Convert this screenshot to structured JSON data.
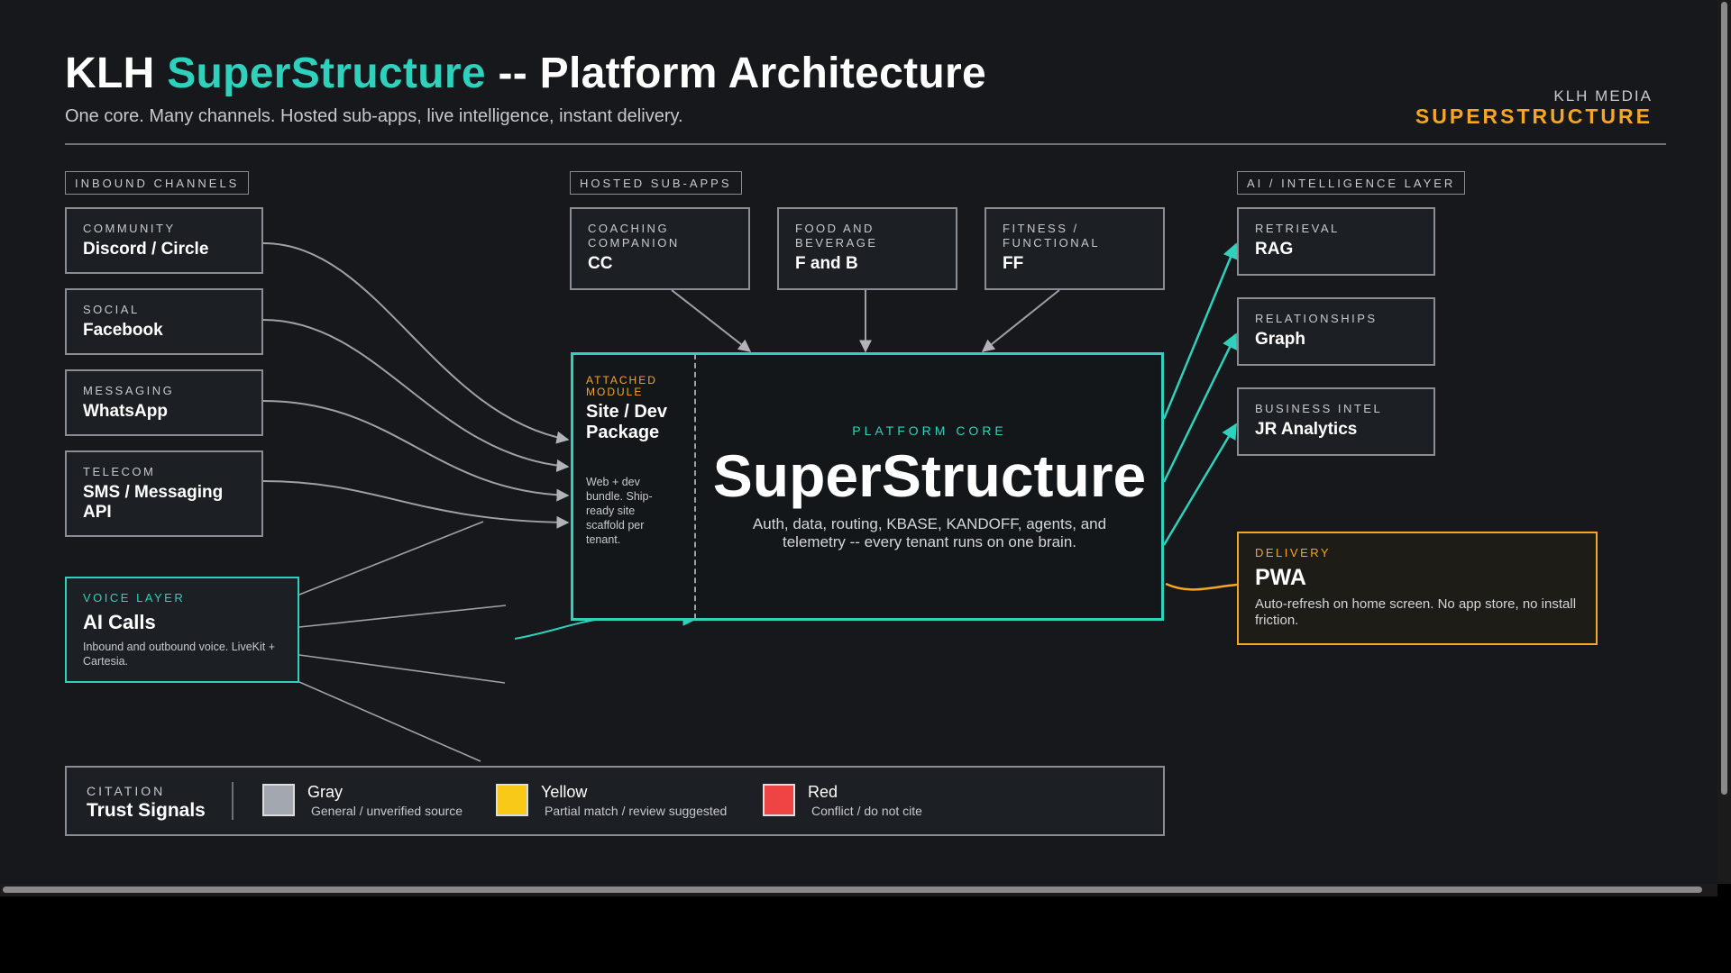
{
  "header": {
    "title_prefix": "KLH",
    "title_accent": "SuperStructure",
    "title_suffix": "-- Platform Architecture",
    "subtitle": "One core. Many channels. Hosted sub-apps, live intelligence, instant delivery.",
    "brand_top": "KLH MEDIA",
    "brand_main": "SUPERSTRUCTURE"
  },
  "sections": {
    "inbound": "INBOUND CHANNELS",
    "hosted": "HOSTED SUB-APPS",
    "ai": "AI / INTELLIGENCE LAYER"
  },
  "inbound": [
    {
      "caption": "COMMUNITY",
      "name": "Discord / Circle"
    },
    {
      "caption": "SOCIAL",
      "name": "Facebook"
    },
    {
      "caption": "MESSAGING",
      "name": "WhatsApp"
    },
    {
      "caption": "TELECOM",
      "name": "SMS / Messaging API"
    }
  ],
  "hosted": [
    {
      "caption": "COACHING COMPANION",
      "name": "CC"
    },
    {
      "caption": "FOOD AND BEVERAGE",
      "name": "F and B"
    },
    {
      "caption": "FITNESS / FUNCTIONAL",
      "name": "FF"
    }
  ],
  "ai": [
    {
      "caption": "RETRIEVAL",
      "name": "RAG"
    },
    {
      "caption": "RELATIONSHIPS",
      "name": "Graph"
    },
    {
      "caption": "BUSINESS INTEL",
      "name": "JR Analytics"
    }
  ],
  "core": {
    "attached_caption": "ATTACHED MODULE",
    "attached_title": "Site / Dev Package",
    "attached_desc": "Web + dev bundle. Ship-ready site scaffold per tenant.",
    "caption": "PLATFORM CORE",
    "title": "SuperStructure",
    "desc": "Auth, data, routing, KBASE, KANDOFF, agents, and telemetry -- every tenant runs on one brain."
  },
  "voice": {
    "caption": "VOICE LAYER",
    "title": "AI Calls",
    "desc": "Inbound and outbound voice. LiveKit + Cartesia."
  },
  "delivery": {
    "caption": "DELIVERY",
    "title": "PWA",
    "desc": "Auto-refresh on home screen. No app store, no install friction."
  },
  "legend": {
    "caption": "CITATION",
    "title": "Trust Signals",
    "items": [
      {
        "label": "Gray",
        "desc": "General / unverified source",
        "color": "#a3a8b0"
      },
      {
        "label": "Yellow",
        "desc": "Partial match / review suggested",
        "color": "#f8c919"
      },
      {
        "label": "Red",
        "desc": "Conflict / do not cite",
        "color": "#ef4444"
      }
    ]
  },
  "colors": {
    "background": "#16181b",
    "teal_accent": "#2fd1bd",
    "orange_accent": "#f5a623",
    "border_gray": "#8a8e94"
  }
}
